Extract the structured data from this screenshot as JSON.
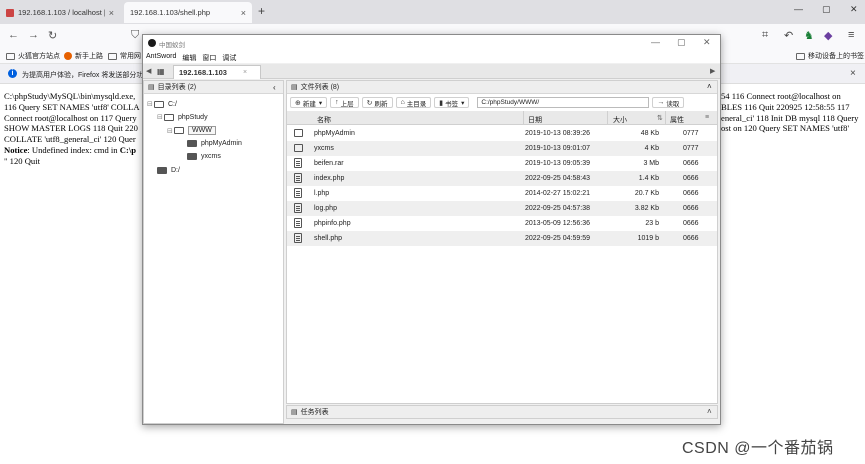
{
  "browser": {
    "tabs": [
      {
        "title": "192.168.1.103 / localhost | ph",
        "close": "×"
      },
      {
        "title": "192.168.1.103/shell.php",
        "close": "×"
      }
    ],
    "new_tab": "+",
    "window_controls": [
      "—",
      "▢",
      "✕"
    ],
    "bookmarks": [
      "火狐官方站点",
      "新手上路",
      "常用网"
    ],
    "other_bookmarks": "移动设备上的书签",
    "notification": "为提高用户体验，Firefox 将发送部分功",
    "notification_close": "×"
  },
  "page": {
    "left_lines": [
      "C:\\phpStudy\\MySQL\\bin\\mysqld.exe,",
      "116 Query SET NAMES 'utf8' COLLA",
      "Connect root@localhost on 117 Query",
      "SHOW MASTER LOGS 118 Quit 220",
      "COLLATE 'utf8_general_ci' 120 Quer"
    ],
    "notice_label": "Notice",
    "notice_text": ": Undefined index: cmd in ",
    "notice_path": "C:\\p",
    "quit_line": "\" 120 Quit",
    "right_lines": [
      "54 116 Connect root@localhost on",
      "BLES 116 Quit 220925 12:58:55 117",
      "eneral_ci' 118 Init DB mysql 118 Query",
      "ost on 120 Query SET NAMES 'utf8'"
    ]
  },
  "antsword": {
    "title": "中国蚁剑",
    "window_controls": [
      "—",
      "▢",
      "✕"
    ],
    "menu": [
      "AntSword",
      "编辑",
      "窗口",
      "调试"
    ],
    "site_tab": "192.168.1.103",
    "site_tab_close": "×",
    "dir_panel_title": "目录列表 (2)",
    "tree": [
      {
        "label": "C:/",
        "level": 0,
        "twisty": "⊟",
        "icon": "open"
      },
      {
        "label": "phpStudy",
        "level": 1,
        "twisty": "⊟",
        "icon": "open"
      },
      {
        "label": "WWW",
        "level": 2,
        "twisty": "⊟",
        "icon": "selected"
      },
      {
        "label": "phpMyAdmin",
        "level": 3,
        "twisty": "",
        "icon": "closed"
      },
      {
        "label": "yxcms",
        "level": 3,
        "twisty": "",
        "icon": "closed"
      },
      {
        "label": "D:/",
        "level": 0,
        "twisty": "",
        "icon": "closed"
      }
    ],
    "file_panel_title": "文件列表 (8)",
    "toolbar": {
      "new": "新建",
      "up": "上层",
      "refresh": "刷新",
      "home": "主目录",
      "bookmark": "书签",
      "path": "C:/phpStudy/WWW/",
      "read": "读取"
    },
    "columns": [
      "名称",
      "日期",
      "大小",
      "属性"
    ],
    "files": [
      {
        "name": "phpMyAdmin",
        "type": "folder",
        "date": "2019-10-13 08:39:26",
        "size": "48 Kb",
        "perm": "0777"
      },
      {
        "name": "yxcms",
        "type": "folder",
        "date": "2019-10-13 09:01:07",
        "size": "4 Kb",
        "perm": "0777"
      },
      {
        "name": "beifen.rar",
        "type": "file",
        "date": "2019-10-13 09:05:39",
        "size": "3 Mb",
        "perm": "0666"
      },
      {
        "name": "index.php",
        "type": "file",
        "date": "2022-09-25 04:58:43",
        "size": "1.4 Kb",
        "perm": "0666"
      },
      {
        "name": "l.php",
        "type": "file",
        "date": "2014-02-27 15:02:21",
        "size": "20.7 Kb",
        "perm": "0666"
      },
      {
        "name": "log.php",
        "type": "file",
        "date": "2022-09-25 04:57:38",
        "size": "3.82 Kb",
        "perm": "0666"
      },
      {
        "name": "phpinfo.php",
        "type": "file",
        "date": "2013-05-09 12:56:36",
        "size": "23 b",
        "perm": "0666"
      },
      {
        "name": "shell.php",
        "type": "file",
        "date": "2022-09-25 04:59:59",
        "size": "1019 b",
        "perm": "0666"
      }
    ],
    "tasks_title": "任务列表"
  },
  "watermark": "CSDN @一个番茄锅"
}
